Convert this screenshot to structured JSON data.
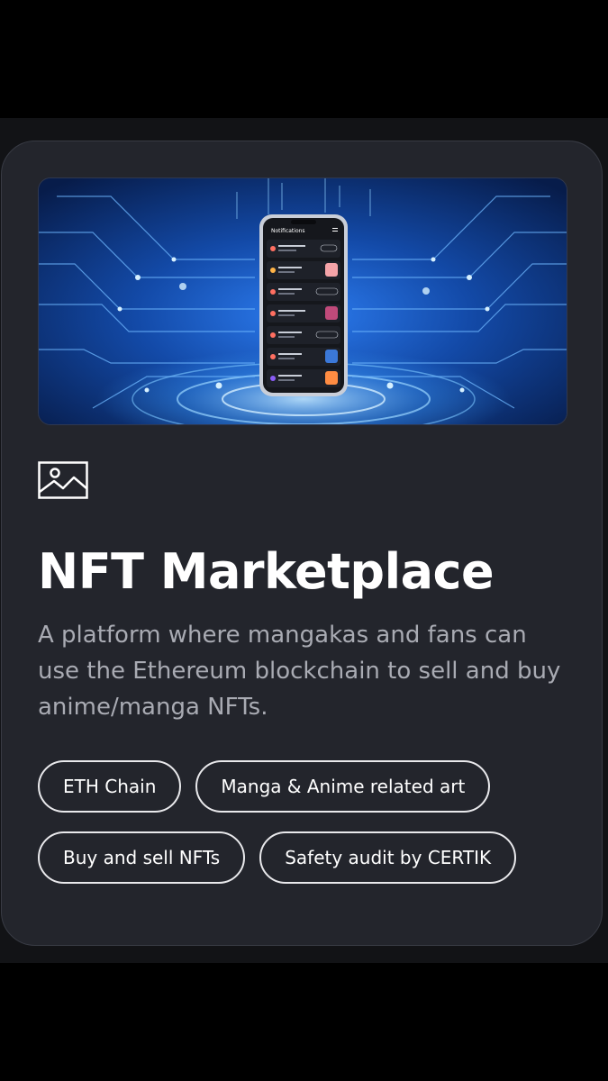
{
  "card": {
    "hero_image_alt": "Phone showing notifications on a blue circuit background",
    "phone_screen_title": "Notifications",
    "title": "NFT Marketplace",
    "description": "A platform where mangakas and fans can use the Ethereum blockchain to sell and buy anime/manga NFTs.",
    "icon": "image-icon",
    "tags": [
      [
        "ETH Chain",
        "Manga & Anime related art"
      ],
      [
        "Buy and sell NFTs",
        "Safety audit by CERTIK"
      ]
    ]
  },
  "colors": {
    "background": "#000000",
    "band": "#121316",
    "card": "#23252c",
    "title": "#ffffff",
    "description": "#a9abb3",
    "tag_border": "#e9e9ec",
    "hero_blue": "#1f5fd0"
  }
}
